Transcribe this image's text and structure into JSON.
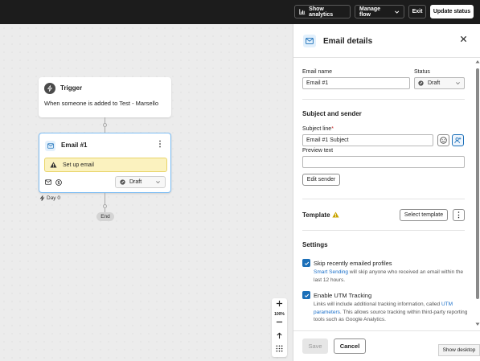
{
  "topbar": {
    "show_analytics": "Show analytics",
    "manage_flow": "Manage flow",
    "exit": "Exit",
    "update_status": "Update status"
  },
  "canvas": {
    "trigger": {
      "title": "Trigger",
      "description": "When someone is added to Test - Marsello",
      "icon": "lightning-icon"
    },
    "email_card": {
      "title": "Email #1",
      "warning": "Set up email",
      "status": "Draft",
      "icon": "envelope-icon"
    },
    "delay_label": "Day 0",
    "end_label": "End",
    "zoom": {
      "level": "100%"
    }
  },
  "panel": {
    "title": "Email details",
    "email_name_label": "Email name",
    "email_name_value": "Email #1",
    "status_label": "Status",
    "status_value": "Draft",
    "subject_section": "Subject and sender",
    "subject_label": "Subject line",
    "required_mark": "*",
    "subject_value": "Email #1 Subject",
    "preview_label": "Preview text",
    "preview_value": "",
    "edit_sender": "Edit sender",
    "template_label": "Template",
    "select_template": "Select template",
    "settings_title": "Settings",
    "skip_label": "Skip recently emailed profiles",
    "skip_link": "Smart Sending",
    "skip_desc_rest": " will skip anyone who received an email within the last 12 hours.",
    "utm_label": "Enable UTM Tracking",
    "utm_desc_pre": "Links will include additional tracking information, called ",
    "utm_link": "UTM parameters",
    "utm_desc_post": ". This allows source tracking within third-party reporting tools such as Google Analytics.",
    "save": "Save",
    "cancel": "Cancel"
  },
  "tooltip": "Show desktop",
  "colors": {
    "accent": "#1b6fb8",
    "warning_bg": "#fbf2bf",
    "topbar_bg": "#1c1c1c",
    "card_border": "#7dbdf3"
  }
}
